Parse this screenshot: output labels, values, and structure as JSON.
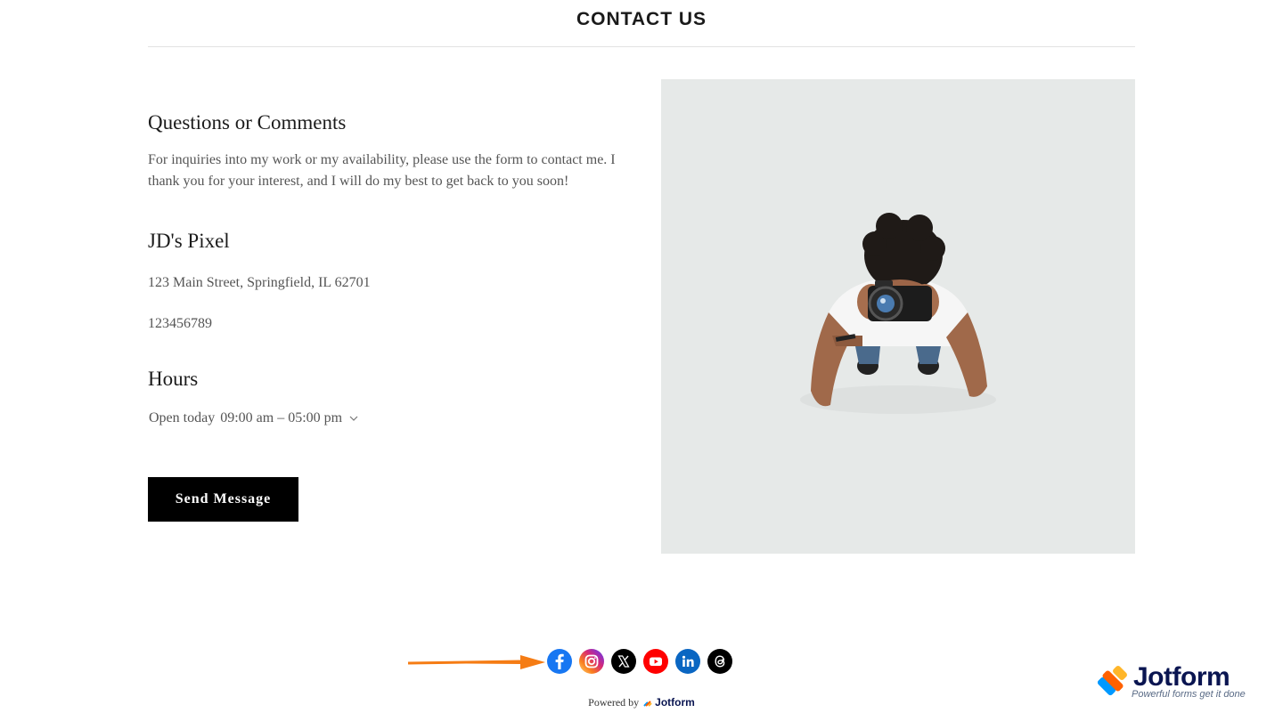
{
  "header": {
    "title": "CONTACT US"
  },
  "intro": {
    "heading": "Questions or Comments",
    "text": "For inquiries into my work or my availability, please use the form to contact me. I thank you for your interest, and I will do my best to get back to you soon!"
  },
  "business": {
    "name": "JD's Pixel",
    "address": "123 Main Street, Springfield, IL 62701",
    "phone": "123456789"
  },
  "hours": {
    "heading": "Hours",
    "status": "Open today",
    "time": "09:00 am – 05:00 pm"
  },
  "actions": {
    "send_label": "Send Message"
  },
  "image": {
    "icon": "photographer-with-camera-photo",
    "background": "#e6e9e8"
  },
  "social": [
    {
      "name": "facebook-icon",
      "color": "#1877f2"
    },
    {
      "name": "instagram-icon",
      "color": "#e1306c"
    },
    {
      "name": "x-icon",
      "color": "#000000"
    },
    {
      "name": "youtube-icon",
      "color": "#ff0000"
    },
    {
      "name": "linkedin-icon",
      "color": "#0a66c2"
    },
    {
      "name": "threads-icon",
      "color": "#000000"
    }
  ],
  "footer": {
    "powered_label": "Powered by",
    "powered_brand": "Jotform",
    "badge_brand": "Jotform",
    "badge_tagline": "Powerful forms get it done"
  },
  "colors": {
    "arrow": "#f57c14",
    "button": "#000000",
    "brand": "#0a1551"
  }
}
